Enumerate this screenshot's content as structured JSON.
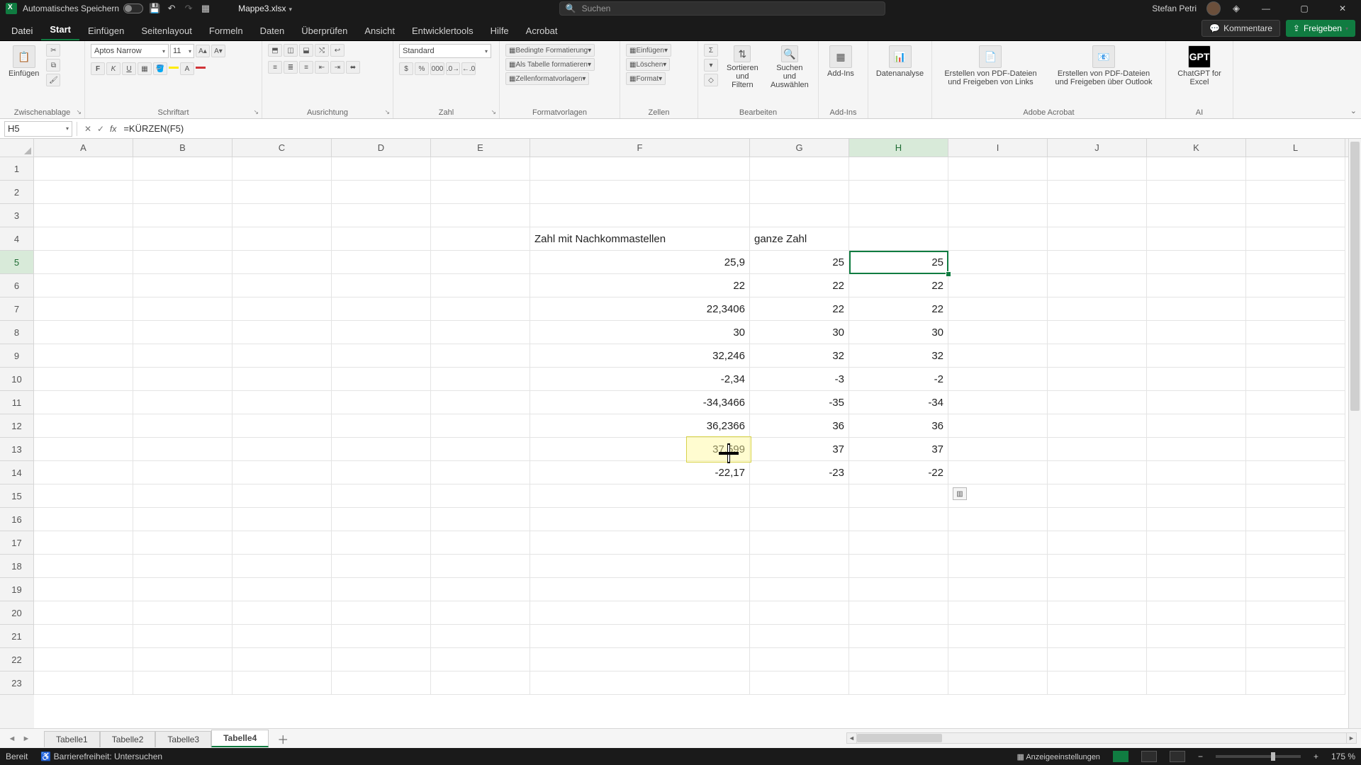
{
  "title": {
    "autosave_label": "Automatisches Speichern",
    "filename": "Mappe3.xlsx",
    "search_placeholder": "Suchen",
    "username": "Stefan Petri"
  },
  "tabs": {
    "file": "Datei",
    "home": "Start",
    "insert": "Einfügen",
    "pagelayout": "Seitenlayout",
    "formulas": "Formeln",
    "data": "Daten",
    "review": "Überprüfen",
    "view": "Ansicht",
    "dev": "Entwicklertools",
    "help": "Hilfe",
    "acrobat": "Acrobat",
    "comments": "Kommentare",
    "share": "Freigeben"
  },
  "ribbon": {
    "clipboard": {
      "paste": "Einfügen",
      "group": "Zwischenablage"
    },
    "font": {
      "name": "Aptos Narrow",
      "size": "11",
      "group": "Schriftart"
    },
    "alignment": {
      "group": "Ausrichtung"
    },
    "number": {
      "format": "Standard",
      "group": "Zahl"
    },
    "styles": {
      "cond": "Bedingte Formatierung",
      "table": "Als Tabelle formatieren",
      "cell": "Zellenformatvorlagen",
      "group": "Formatvorlagen"
    },
    "cells": {
      "insert": "Einfügen",
      "delete": "Löschen",
      "format": "Format",
      "group": "Zellen"
    },
    "editing": {
      "sort": "Sortieren und Filtern",
      "find": "Suchen und Auswählen",
      "group": "Bearbeiten"
    },
    "addins": {
      "label": "Add-Ins",
      "group": "Add-Ins"
    },
    "analysis": {
      "label": "Datenanalyse"
    },
    "adobe": {
      "btn1": "Erstellen von PDF-Dateien und Freigeben von Links",
      "btn2": "Erstellen von PDF-Dateien und Freigeben über Outlook",
      "group": "Adobe Acrobat"
    },
    "ai": {
      "label": "ChatGPT for Excel",
      "group": "AI"
    }
  },
  "formula": {
    "cell_ref": "H5",
    "formula": "=KÜRZEN(F5)"
  },
  "columns": [
    "A",
    "B",
    "C",
    "D",
    "E",
    "F",
    "G",
    "H",
    "I",
    "J",
    "K",
    "L"
  ],
  "selected_col": "H",
  "selected_row": 5,
  "row_count": 23,
  "headers": {
    "F4": "Zahl mit Nachkommastellen",
    "G4": "ganze Zahl"
  },
  "data_rows": [
    {
      "F": "25,9",
      "G": "25",
      "H": "25"
    },
    {
      "F": "22",
      "G": "22",
      "H": "22"
    },
    {
      "F": "22,3406",
      "G": "22",
      "H": "22"
    },
    {
      "F": "30",
      "G": "30",
      "H": "30"
    },
    {
      "F": "32,246",
      "G": "32",
      "H": "32"
    },
    {
      "F": "-2,34",
      "G": "-3",
      "H": "-2"
    },
    {
      "F": "-34,3466",
      "G": "-35",
      "H": "-34"
    },
    {
      "F": "36,2366",
      "G": "36",
      "H": "36"
    },
    {
      "F": "37,599",
      "G": "37",
      "H": "37"
    },
    {
      "F": "-22,17",
      "G": "-23",
      "H": "-22"
    }
  ],
  "sheet_tabs": {
    "tabs": [
      "Tabelle1",
      "Tabelle2",
      "Tabelle3",
      "Tabelle4"
    ],
    "active": "Tabelle4"
  },
  "status": {
    "ready": "Bereit",
    "accessibility": "Barrierefreiheit: Untersuchen",
    "display_settings": "Anzeigeeinstellungen",
    "zoom": "175 %"
  }
}
